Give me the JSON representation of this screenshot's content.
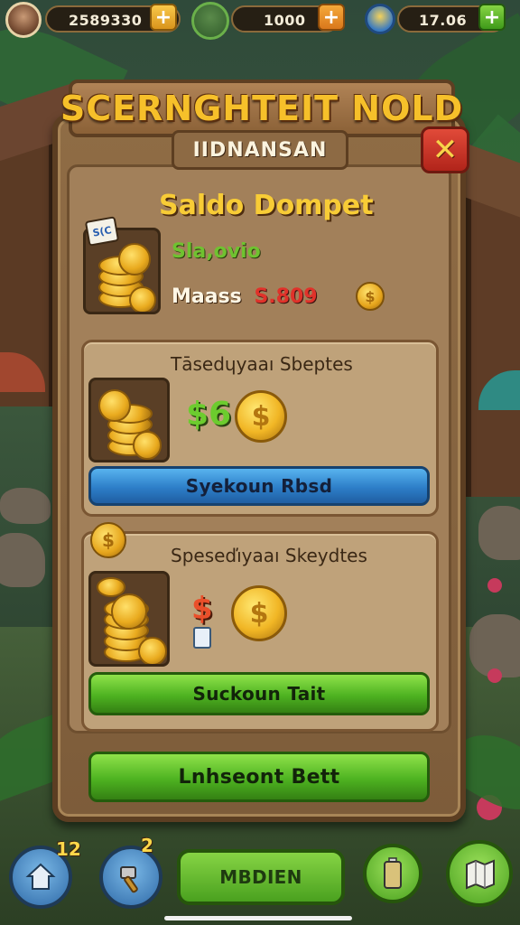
{
  "topbar": {
    "coins": "2589330",
    "gems": "1000",
    "energy": "17.06",
    "avatar_icon": "player-avatar",
    "npc_icon": "npc-portrait",
    "map_icon": "location-pin"
  },
  "dialog": {
    "title": "SCERNGHTEIT NOLD",
    "subtitle": "IIDNANSAN",
    "close_label": "✕"
  },
  "wallet": {
    "heading": "Saldo Dompet",
    "sub": "Sla,ovio",
    "tag": "S(C",
    "label": "Maass",
    "amount": "S.809"
  },
  "offer1": {
    "title": "Tāsedɥyaaı Sbeptes",
    "price": "$6",
    "button": "Syekoun Rbsd"
  },
  "offer2": {
    "title": "Speseďıyaaı Skeydtes",
    "price_glyph": "$",
    "button": "Suckoun Tait"
  },
  "confirm_button": "Lnhseont Bett",
  "bottom_nav": {
    "home_badge": "12",
    "tools_badge": "2",
    "center_label": "MBDIEN"
  },
  "colors": {
    "gold": "#f6c02a",
    "panel": "#8f6c45",
    "blue_button": "#2d7ec8",
    "green_button": "#4eb321",
    "close_red": "#d2342a"
  }
}
